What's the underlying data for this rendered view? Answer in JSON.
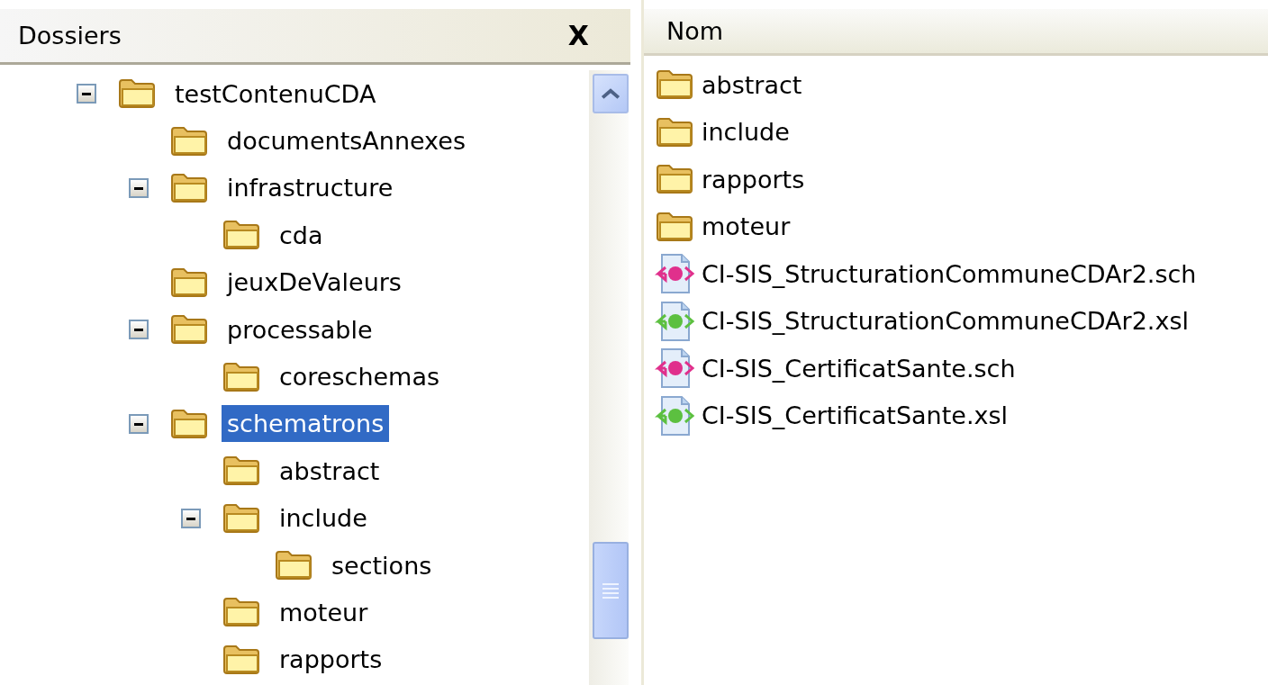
{
  "folders_pane": {
    "title": "Dossiers",
    "close": "X",
    "tree": [
      {
        "name": "testContenuCDA",
        "expanded": true,
        "selected": false,
        "children": [
          {
            "name": "documentsAnnexes",
            "selected": false
          },
          {
            "name": "infrastructure",
            "expanded": true,
            "selected": false,
            "children": [
              {
                "name": "cda",
                "selected": false
              }
            ]
          },
          {
            "name": "jeuxDeValeurs",
            "selected": false
          },
          {
            "name": "processable",
            "expanded": true,
            "selected": false,
            "children": [
              {
                "name": "coreschemas",
                "selected": false
              }
            ]
          },
          {
            "name": "schematrons",
            "expanded": true,
            "selected": true,
            "children": [
              {
                "name": "abstract",
                "selected": false
              },
              {
                "name": "include",
                "expanded": true,
                "selected": false,
                "children": [
                  {
                    "name": "sections",
                    "selected": false
                  }
                ]
              },
              {
                "name": "moteur",
                "selected": false
              },
              {
                "name": "rapports",
                "selected": false
              }
            ]
          }
        ]
      }
    ]
  },
  "files_pane": {
    "column": "Nom",
    "items": [
      {
        "kind": "folder",
        "name": "abstract"
      },
      {
        "kind": "folder",
        "name": "include"
      },
      {
        "kind": "folder",
        "name": "rapports"
      },
      {
        "kind": "folder",
        "name": "moteur"
      },
      {
        "kind": "file",
        "name": "CI-SIS_StructurationCommuneCDAr2.sch",
        "color": "#e0308c"
      },
      {
        "kind": "file",
        "name": "CI-SIS_StructurationCommuneCDAr2.xsl",
        "color": "#5cc040"
      },
      {
        "kind": "file",
        "name": "CI-SIS_CertificatSante.sch",
        "color": "#e0308c"
      },
      {
        "kind": "file",
        "name": "CI-SIS_CertificatSante.xsl",
        "color": "#5cc040"
      }
    ]
  }
}
